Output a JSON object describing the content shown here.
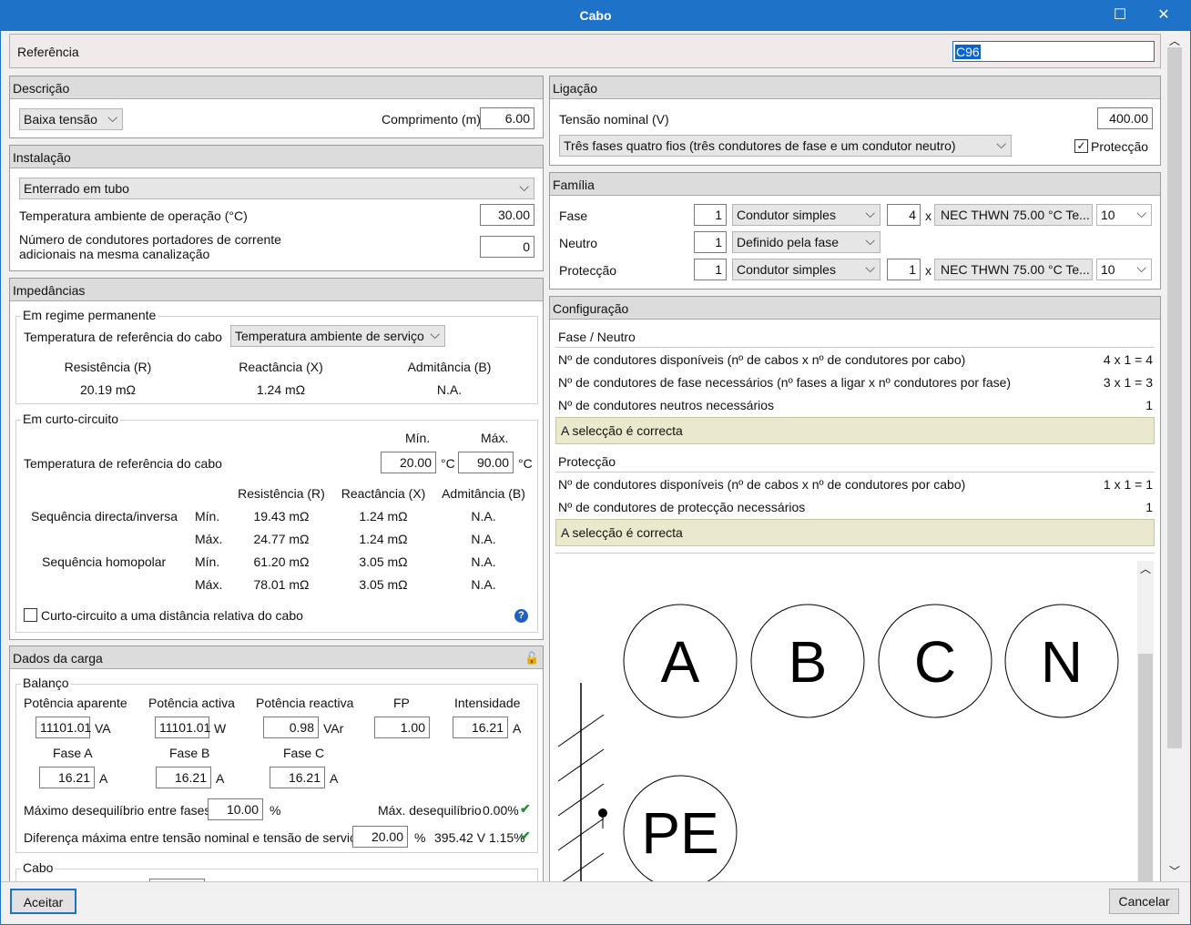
{
  "window": {
    "title": "Cabo"
  },
  "ref": {
    "label": "Referência",
    "value": "C96"
  },
  "descricao": {
    "header": "Descrição",
    "tipo": "Baixa tensão",
    "comp_label": "Comprimento (m)",
    "comp_value": "6.00"
  },
  "instalacao": {
    "header": "Instalação",
    "tipo": "Enterrado em tubo",
    "temp_label": "Temperatura ambiente de operação (°C)",
    "temp_value": "30.00",
    "ncond_label1": "Número de condutores portadores de corrente",
    "ncond_label2": "adicionais na mesma canalização",
    "ncond_value": "0"
  },
  "imp": {
    "header": "Impedâncias",
    "perm_title": "Em regime permanente",
    "perm_temp_label": "Temperatura de referência do cabo",
    "perm_temp_sel": "Temperatura ambiente de serviço",
    "h_res": "Resistência (R)",
    "h_reac": "Reactância (X)",
    "h_adm": "Admitância (B)",
    "perm_res": "20.19 mΩ",
    "perm_reac": "1.24 mΩ",
    "perm_adm": "N.A.",
    "cc_title": "Em curto-circuito",
    "min": "Mín.",
    "max": "Máx.",
    "cc_temp_label": "Temperatura de referência do cabo",
    "cc_tmin": "20.00",
    "cc_tmax": "90.00",
    "unit_c": "°C",
    "seq_dir": "Sequência directa/inversa",
    "seq_homo": "Sequência homopolar",
    "rows": [
      {
        "lim": "Mín.",
        "r": "19.43 mΩ",
        "x": "1.24 mΩ",
        "b": "N.A."
      },
      {
        "lim": "Máx.",
        "r": "24.77 mΩ",
        "x": "1.24 mΩ",
        "b": "N.A."
      },
      {
        "lim": "Mín.",
        "r": "61.20 mΩ",
        "x": "3.05 mΩ",
        "b": "N.A."
      },
      {
        "lim": "Máx.",
        "r": "78.01 mΩ",
        "x": "3.05 mΩ",
        "b": "N.A."
      }
    ],
    "cc_dist": "Curto-circuito a uma distância relativa do cabo"
  },
  "carga": {
    "header": "Dados da carga",
    "balanco": "Balanço",
    "pap_label": "Potência aparente",
    "pap": "11101.01",
    "pap_u": "VA",
    "pact_label": "Potência activa",
    "pact": "11101.01",
    "pact_u": "W",
    "preac_label": "Potência reactiva",
    "preac": "0.98",
    "preac_u": "VAr",
    "fp_label": "FP",
    "fp": "1.00",
    "int_label": "Intensidade",
    "int": "16.21",
    "int_u": "A",
    "fa_label": "Fase A",
    "fa": "16.21",
    "fb_label": "Fase B",
    "fb": "16.21",
    "fc_label": "Fase C",
    "fc": "16.21",
    "amp": "A",
    "deseq_label": "Máximo desequilíbrio entre fases",
    "deseq": "10.00",
    "pct": "%",
    "mdeseq_label": "Máx. desequilíbrio",
    "mdeseq": "0.00%",
    "dif_label": "Diferença máxima entre tensão nominal e tensão de serviço",
    "dif": "20.00",
    "dif_res": "395.42 V 1.15%",
    "cabo": "Cabo"
  },
  "ligacao": {
    "header": "Ligação",
    "tensao_label": "Tensão nominal (V)",
    "tensao": "400.00",
    "sistema": "Três fases quatro fios (três condutores de fase e um condutor neutro)",
    "prot": "Protecção"
  },
  "familia": {
    "header": "Família",
    "rows": [
      {
        "label": "Fase",
        "n": "1",
        "tipo": "Condutor simples",
        "m": "4",
        "x": "x",
        "cabo": "NEC THWN 75.00 °C Te...",
        "sec": "10"
      },
      {
        "label": "Neutro",
        "n": "1",
        "tipo": "Definido pela fase"
      },
      {
        "label": "Protecção",
        "n": "1",
        "tipo": "Condutor simples",
        "m": "1",
        "x": "x",
        "cabo": "NEC THWN 75.00 °C Te...",
        "sec": "10"
      }
    ]
  },
  "config": {
    "header": "Configuração",
    "fn_title": "Fase / Neutro",
    "fn1": "Nº de condutores disponíveis (nº de cabos x nº de condutores por cabo)",
    "fn1v": "4 x 1 = 4",
    "fn2": "Nº de condutores de fase necessários (nº fases a ligar x nº condutores por fase)",
    "fn2v": "3 x 1 = 3",
    "fn3": "Nº de condutores neutros necessários",
    "fn3v": "1",
    "ok1": "A selecção é correcta",
    "p_title": "Protecção",
    "p1": "Nº de condutores disponíveis (nº de cabos x nº de condutores por cabo)",
    "p1v": "1 x 1 = 1",
    "p2": "Nº de condutores de protecção necessários",
    "p2v": "1",
    "ok2": "A selecção é correcta",
    "circles": [
      "A",
      "B",
      "C",
      "N",
      "PE"
    ]
  },
  "buttons": {
    "ok": "Aceitar",
    "cancel": "Cancelar"
  },
  "colors": {
    "titlebar": "#1e73c8",
    "ok_bg": "#eae9cd",
    "check": "#2e8b2e"
  }
}
